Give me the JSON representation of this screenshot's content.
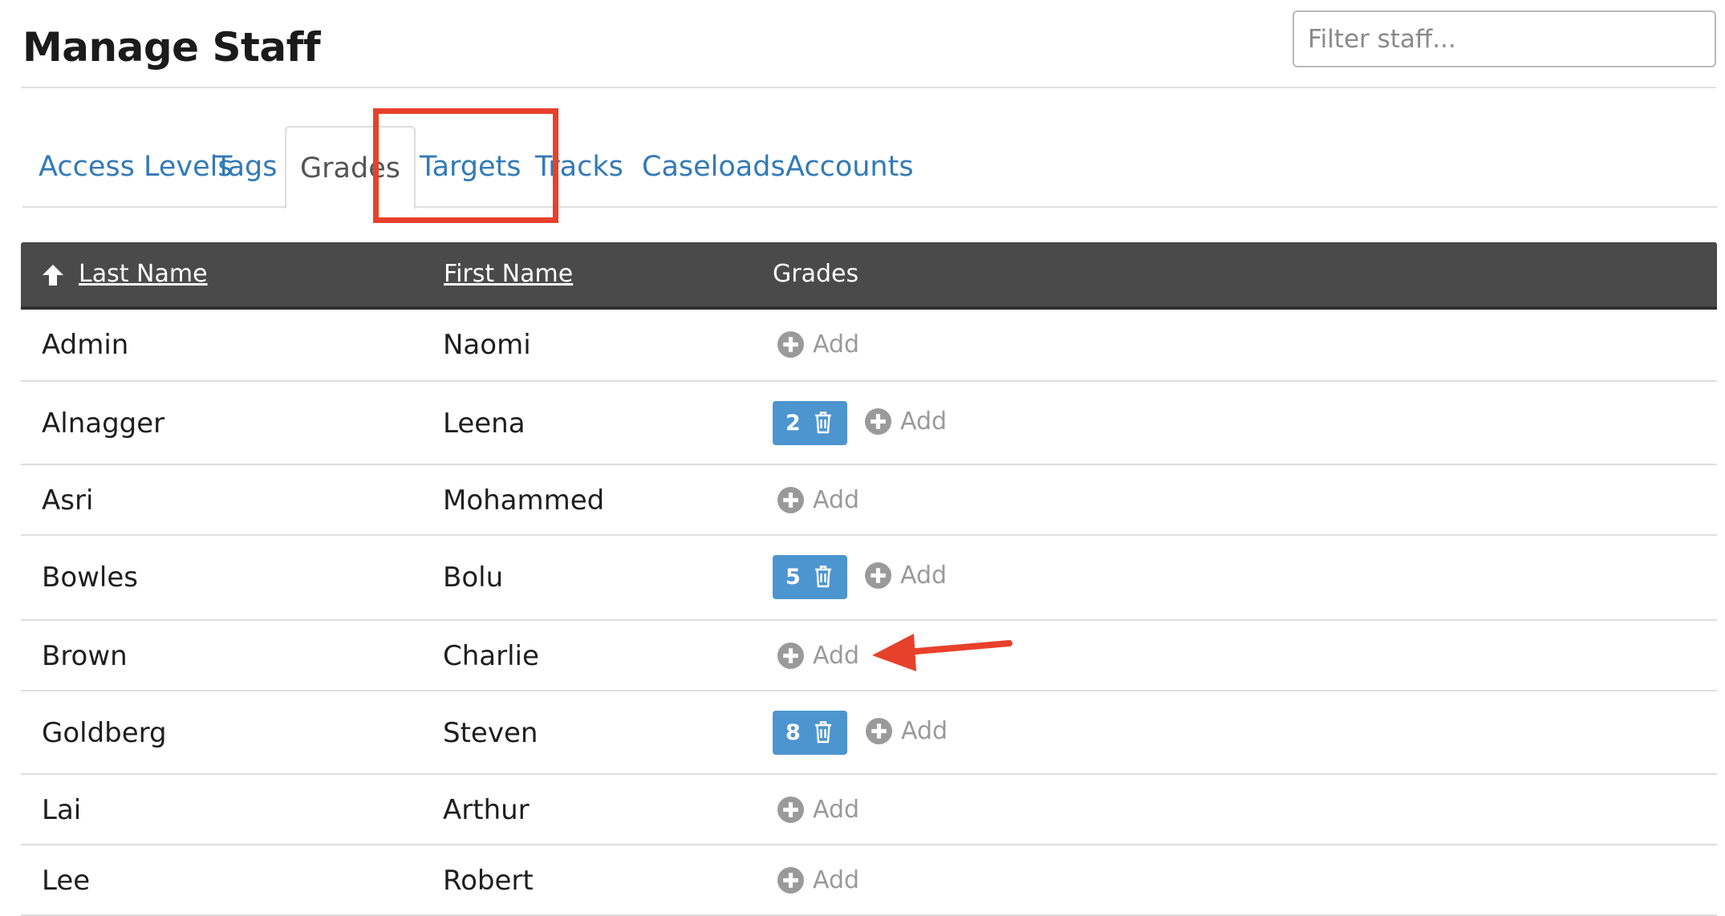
{
  "header": {
    "title": "Manage Staff",
    "filter_placeholder": "Filter staff..."
  },
  "tabs": [
    {
      "label": "Access Levels",
      "active": false
    },
    {
      "label": "Tags",
      "active": false
    },
    {
      "label": "Grades",
      "active": true
    },
    {
      "label": "Targets",
      "active": false
    },
    {
      "label": "Tracks",
      "active": false
    },
    {
      "label": "Caseloads",
      "active": false
    },
    {
      "label": "Accounts",
      "active": false
    }
  ],
  "table": {
    "columns": {
      "last_name": "Last Name",
      "first_name": "First Name",
      "grades": "Grades"
    },
    "sort": {
      "column": "last_name",
      "direction": "ascending",
      "icon": "arrow-up-icon"
    },
    "add_label": "Add",
    "rows": [
      {
        "last": "Admin",
        "first": "Naomi",
        "grade": null
      },
      {
        "last": "Alnagger",
        "first": "Leena",
        "grade": "2"
      },
      {
        "last": "Asri",
        "first": "Mohammed",
        "grade": null
      },
      {
        "last": "Bowles",
        "first": "Bolu",
        "grade": "5"
      },
      {
        "last": "Brown",
        "first": "Charlie",
        "grade": null
      },
      {
        "last": "Goldberg",
        "first": "Steven",
        "grade": "8"
      },
      {
        "last": "Lai",
        "first": "Arthur",
        "grade": null
      },
      {
        "last": "Lee",
        "first": "Robert",
        "grade": null
      }
    ]
  },
  "annotations": {
    "highlight_color": "#e8412b",
    "highlight_target": "Grades tab",
    "arrow_target": "Add button in the Brown / Charlie row"
  },
  "colors": {
    "link": "#337ab7",
    "table_header": "#4a4a4a",
    "badge": "#4d95cf",
    "add_icon": "#9a9a9a"
  }
}
